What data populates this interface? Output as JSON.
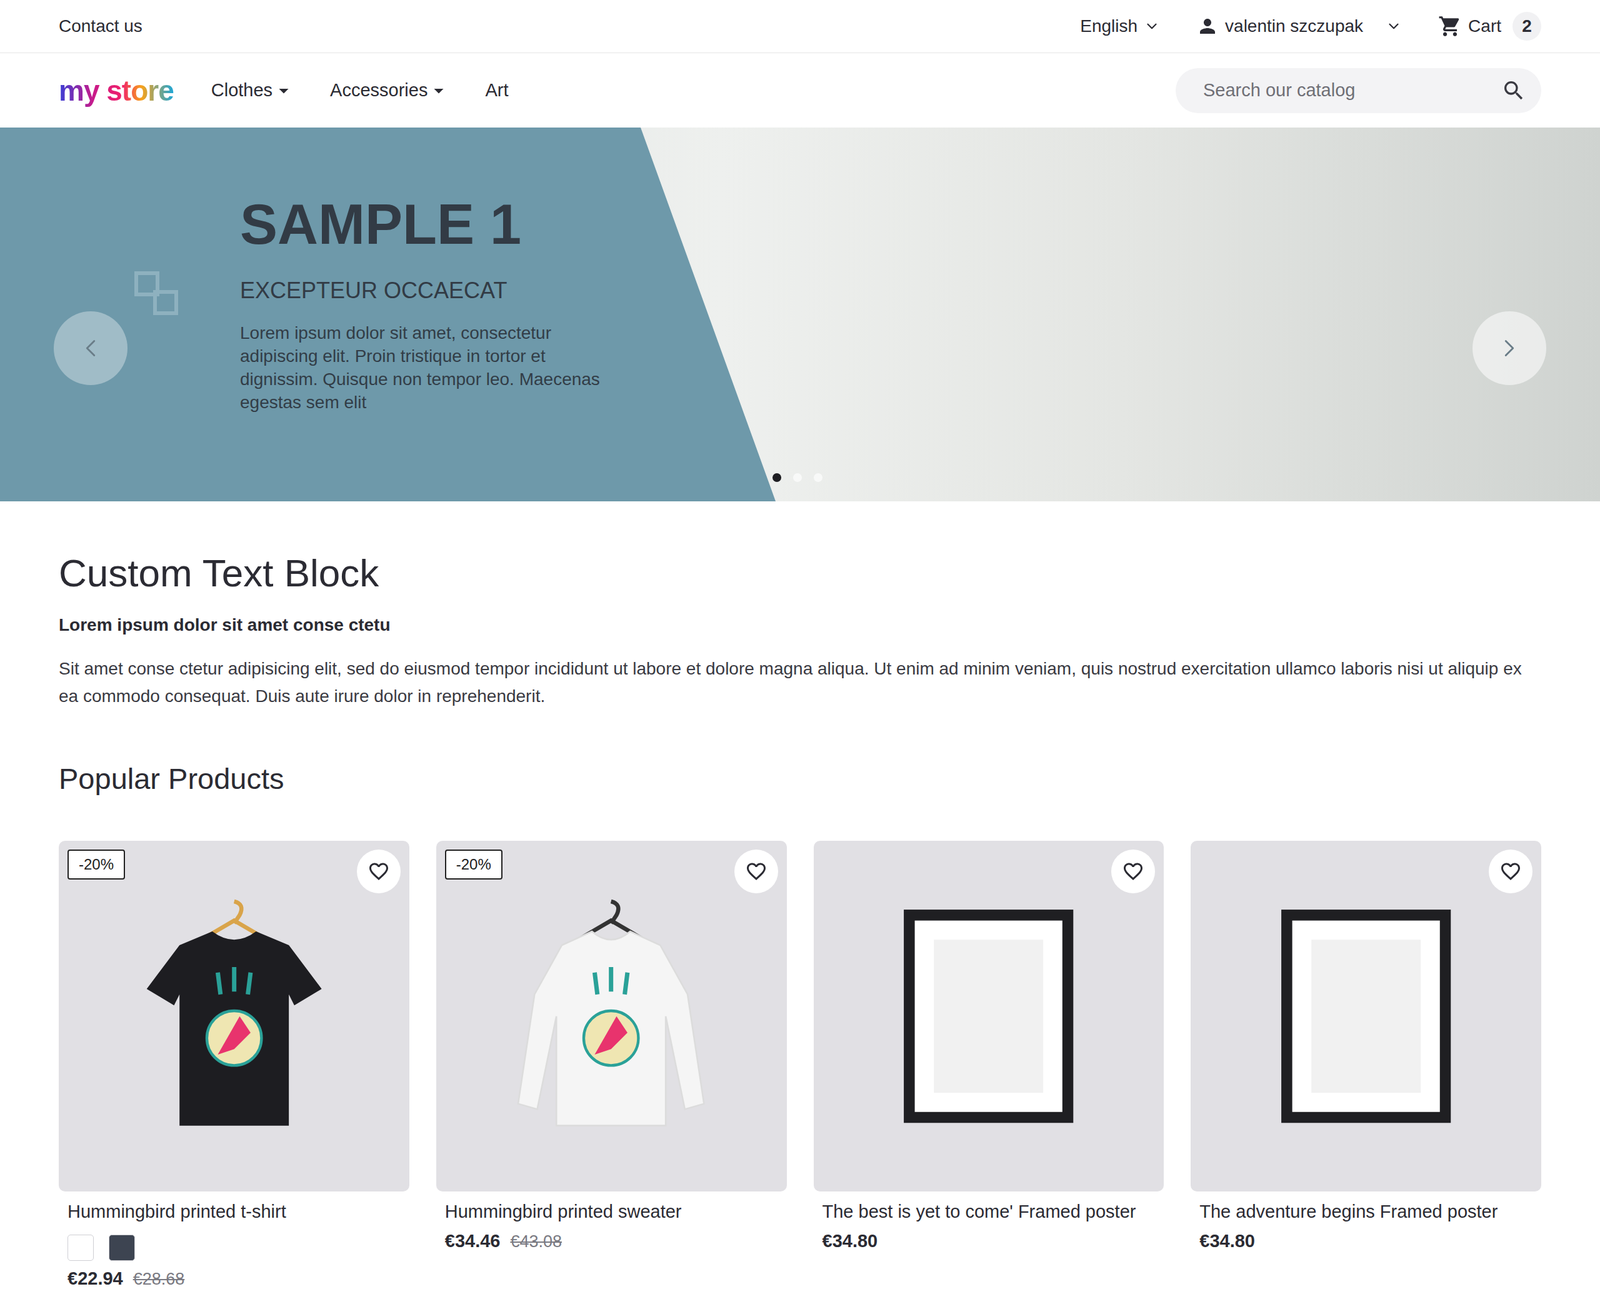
{
  "topbar": {
    "contact": "Contact us",
    "language": "English",
    "user": "valentin szczupak",
    "cart": {
      "label": "Cart",
      "count": "2"
    }
  },
  "header": {
    "logo": "my store",
    "nav": [
      {
        "label": "Clothes",
        "dropdown": true
      },
      {
        "label": "Accessories",
        "dropdown": true
      },
      {
        "label": "Art",
        "dropdown": false
      }
    ],
    "search": {
      "placeholder": "Search our catalog"
    }
  },
  "hero": {
    "title": "SAMPLE 1",
    "subtitle": "EXCEPTEUR OCCAECAT",
    "text": "Lorem ipsum dolor sit amet, consectetur adipiscing elit. Proin tristique in tortor et dignissim. Quisque non tempor leo. Maecenas egestas sem elit",
    "dots": [
      {
        "selected": true
      },
      {
        "selected": false
      },
      {
        "selected": false
      }
    ]
  },
  "custom_text": {
    "title": "Custom Text Block",
    "lead": "Lorem ipsum dolor sit amet conse ctetu",
    "text": "Sit amet conse ctetur adipisicing elit, sed do eiusmod tempor incididunt ut labore et dolore magna aliqua. Ut enim ad minim veniam, quis nostrud exercitation ullamco laboris nisi ut aliquip ex ea commodo consequat. Duis aute irure dolor in reprehenderit."
  },
  "popular": {
    "title": "Popular Products",
    "products": [
      {
        "name": "Hummingbird printed t-shirt",
        "kind": "tshirt",
        "discount": "-20%",
        "wishlisted": false,
        "colors": [
          {
            "color": "#ffffff"
          },
          {
            "color": "#3d4451"
          }
        ],
        "price": "€22.94",
        "old_price": "€28.68"
      },
      {
        "name": "Hummingbird printed sweater",
        "kind": "sweater",
        "discount": "-20%",
        "wishlisted": false,
        "colors": [],
        "price": "€34.46",
        "old_price": "€43.08"
      },
      {
        "name": "The best is yet to come' Framed poster",
        "kind": "poster",
        "discount": null,
        "wishlisted": false,
        "colors": [],
        "price": "€34.80",
        "old_price": null
      },
      {
        "name": "The adventure begins Framed poster",
        "kind": "poster",
        "discount": null,
        "wishlisted": false,
        "colors": [],
        "price": "€34.80",
        "old_price": null
      }
    ]
  }
}
